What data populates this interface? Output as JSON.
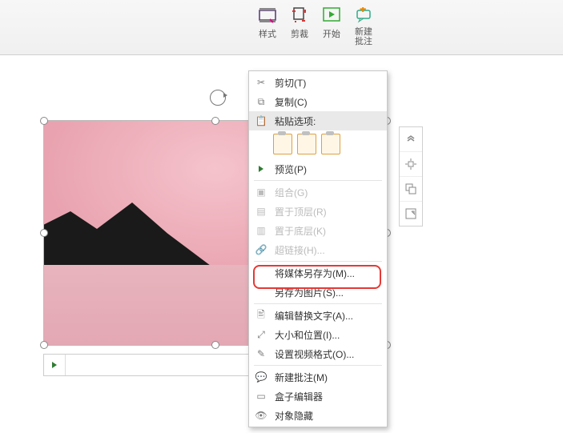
{
  "ribbon": {
    "style": "样式",
    "crop": "剪裁",
    "start": "开始",
    "new_comment": "新建\n批注"
  },
  "sidetool_names": [
    "chevrons-up-icon",
    "align-center-icon",
    "overlap-icon",
    "expand-icon"
  ],
  "menu": {
    "cut": "剪切(T)",
    "copy": "复制(C)",
    "paste_header": "粘贴选项:",
    "preview": "预览(P)",
    "group": "组合(G)",
    "bring_front": "置于顶层(R)",
    "send_back": "置于底层(K)",
    "hyperlink": "超链接(H)...",
    "save_media": "将媒体另存为(M)...",
    "save_image": "另存为图片(S)...",
    "alt_text": "编辑替换文字(A)...",
    "size_pos": "大小和位置(I)...",
    "video_fmt": "设置视频格式(O)...",
    "new_comment": "新建批注(M)",
    "box_editor": "盒子编辑器",
    "hide_obj": "对象隐藏"
  }
}
